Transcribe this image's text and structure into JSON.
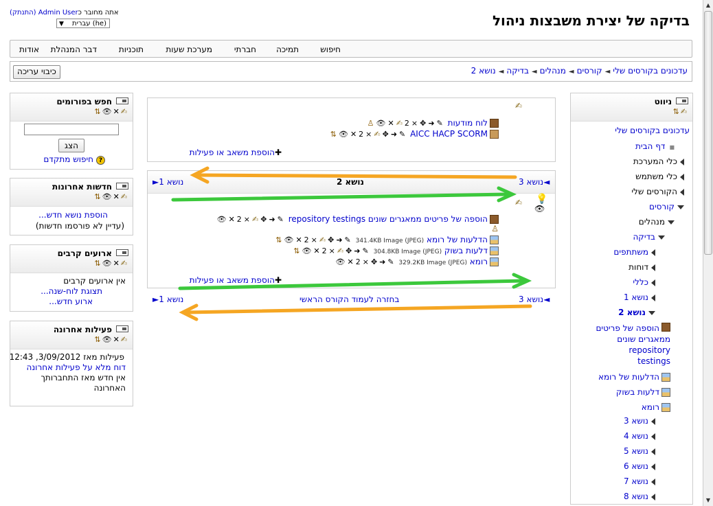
{
  "header": {
    "site_title": "בדיקה של יצירת משבצות ניהול",
    "login_prefix": "אתה מחובר כ",
    "login_user": "Admin User",
    "logout": "(התנתק)",
    "language": "עברית (he)"
  },
  "menu": [
    "חיפוש",
    "תמיכה",
    "חברתי",
    "מערכת שעות",
    "תוכניות",
    "דבר המנהלת",
    "אודות"
  ],
  "breadcrumbs": [
    "עדכונים בקורסים שלי",
    "קורסים",
    "מנהלים",
    "בדיקה",
    "נושא 2"
  ],
  "edit_button": "כיבוי עריכה",
  "nav_block": {
    "title": "ניווט",
    "items": {
      "my_updates": "עדכונים בקורסים שלי",
      "home": "דף הבית",
      "system_tools": "כלי המערכת",
      "user_tools": "כלי משתמש",
      "my_courses": "הקורסים שלי",
      "courses": "קורסים",
      "managers": "מנהלים",
      "test": "בדיקה",
      "participants": "משתתפים",
      "reports": "דוחות",
      "general": "כללי",
      "topic1": "נושא 1",
      "topic2": "נושא 2",
      "res1": "הוספה של פריטים ממאגרים שונים repository testings",
      "res1_a": "הוספה של פריטים",
      "res1_b": "ממאגרים שונים",
      "res1_c": "repository",
      "res1_d": "testings",
      "res2": "הדלעות של רומא",
      "res3": "דלעות בשוק",
      "res4": "רומא",
      "topic3": "נושא 3",
      "topic4": "נושא 4",
      "topic5": "נושא 5",
      "topic6": "נושא 6",
      "topic7": "נושא 7",
      "topic8": "נושא 8"
    }
  },
  "forum_search": {
    "title": "חפש בפורומים",
    "go": "הצג",
    "advanced": "חיפוש מתקדם"
  },
  "news": {
    "title": "חדשות אחרונות",
    "add": "הוספת נושא חדש...",
    "none": "(עדיין לא פורסמו חדשות)"
  },
  "events": {
    "title": "ארועים קרבים",
    "none": "אין ארועים קרבים",
    "calendar": "תצוגת לוח-שנה...",
    "new_event": "ארוע חדש..."
  },
  "recent": {
    "title": "פעילות אחרונה",
    "since": "פעילות מאז 3/09/2012, 12:43",
    "full_report": "דוח מלא על פעילות אחרונה",
    "nothing_1": "אין חדש מאז התחברותך",
    "nothing_2": "האחרונה"
  },
  "center": {
    "top_items": [
      "לוח מודעות",
      "AICC HACP SCORM"
    ],
    "add_activity": "הוספת משאב או פעילות",
    "prev_topic": "נושא 3",
    "next_topic": "נושא 1",
    "section_title": "נושא 2",
    "res1": "הוספה של פריטים ממאגרים שונים repository testings",
    "res2": "הדלעות של רומא",
    "res2_meta": "(341.4KB Image (JPEG",
    "res3": "דלעות בשוק",
    "res3_meta": "(304.8KB Image (JPEG",
    "res4": "רומא",
    "res4_meta": "(329.2KB Image (JPEG",
    "back_main": "בחזרה לעמוד הקורס הראשי"
  },
  "colors": {
    "link": "#0000cc",
    "arrow_orange": "#f5a623",
    "arrow_green": "#3cc83c"
  }
}
